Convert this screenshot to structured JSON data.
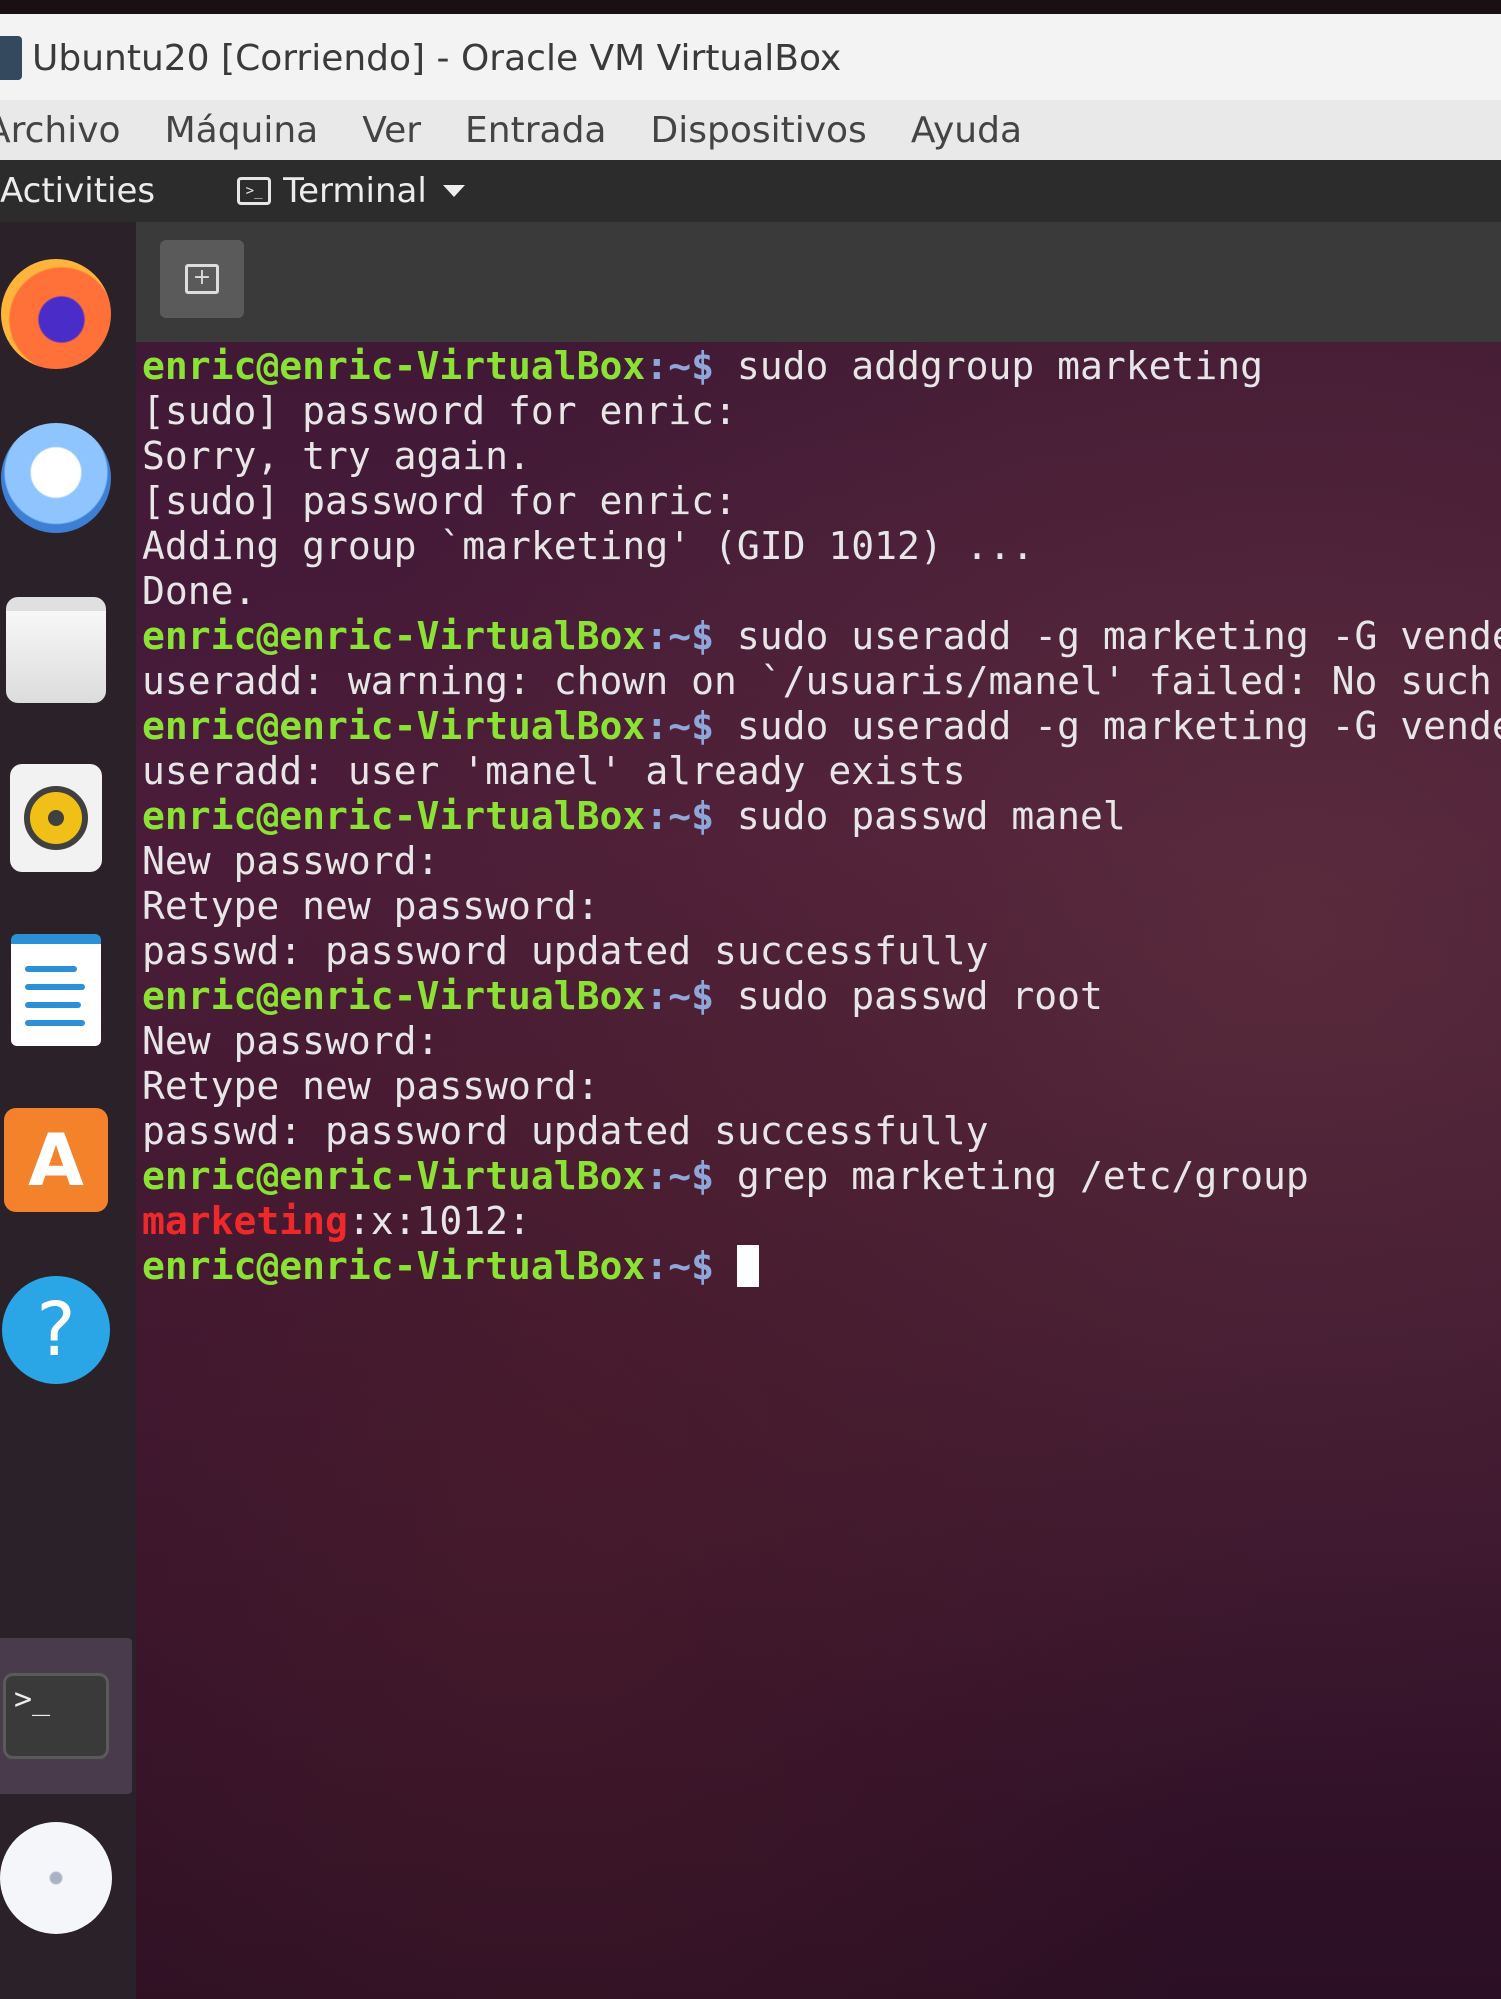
{
  "window": {
    "title": "Ubuntu20 [Corriendo] - Oracle VM VirtualBox",
    "menu": [
      "Archivo",
      "Máquina",
      "Ver",
      "Entrada",
      "Dispositivos",
      "Ayuda"
    ]
  },
  "topbar": {
    "activities": "Activities",
    "app_name": "Terminal"
  },
  "dock": {
    "items": [
      "firefox-icon",
      "thunderbird-icon",
      "files-icon",
      "rhythmbox-icon",
      "libreoffice-writer-icon",
      "ubuntu-software-icon",
      "help-icon",
      "terminal-icon",
      "dvd-icon"
    ],
    "active": "terminal-icon"
  },
  "terminal": {
    "prompt_user": "enric@enric-VirtualBox",
    "prompt_path": ":~$",
    "lines": [
      {
        "type": "cmd",
        "text": " sudo addgroup marketing"
      },
      {
        "type": "out",
        "text": "[sudo] password for enric:"
      },
      {
        "type": "out",
        "text": "Sorry, try again."
      },
      {
        "type": "out",
        "text": "[sudo] password for enric:"
      },
      {
        "type": "out",
        "text": "Adding group `marketing' (GID 1012) ..."
      },
      {
        "type": "out",
        "text": "Done."
      },
      {
        "type": "cmd",
        "text": " sudo useradd -g marketing -G vendes"
      },
      {
        "type": "out",
        "text": "useradd: warning: chown on `/usuaris/manel' failed: No such f"
      },
      {
        "type": "cmd",
        "text": " sudo useradd -g marketing -G vendes"
      },
      {
        "type": "out",
        "text": "useradd: user 'manel' already exists"
      },
      {
        "type": "cmd",
        "text": " sudo passwd manel"
      },
      {
        "type": "out",
        "text": "New password:"
      },
      {
        "type": "out",
        "text": "Retype new password:"
      },
      {
        "type": "out",
        "text": "passwd: password updated successfully"
      },
      {
        "type": "cmd",
        "text": " sudo passwd root"
      },
      {
        "type": "out",
        "text": "New password:"
      },
      {
        "type": "out",
        "text": "Retype new password:"
      },
      {
        "type": "out",
        "text": "passwd: password updated successfully"
      },
      {
        "type": "cmd",
        "text": " grep marketing /etc/group"
      },
      {
        "type": "match",
        "highlight": "marketing",
        "rest": ":x:1012:"
      },
      {
        "type": "prompt",
        "text": " "
      }
    ]
  },
  "colors": {
    "prompt_user": "#8ae234",
    "prompt_path": "#8ea6d8",
    "grep_match": "#ef2929",
    "terminal_bg": "#3e1834"
  }
}
